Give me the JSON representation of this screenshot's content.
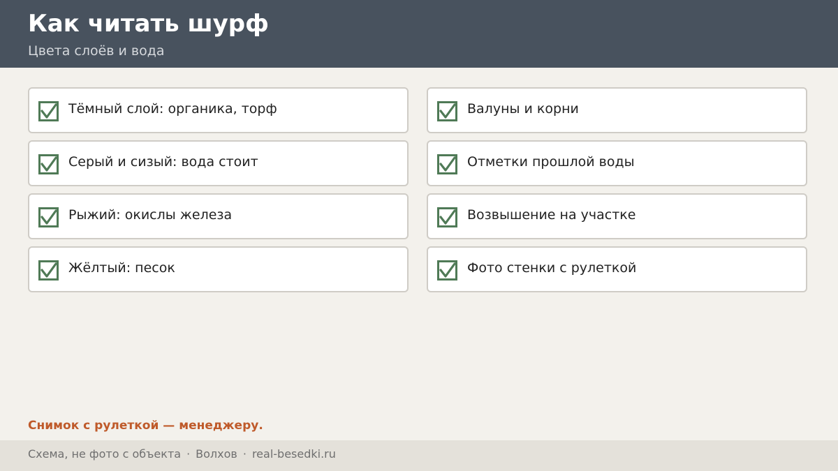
{
  "header": {
    "title": "Как читать шурф",
    "subtitle": "Цвета слоёв и вода"
  },
  "colors": {
    "header_bg": "#48525e",
    "page_bg": "#f3f1ec",
    "check_green": "#4f7a56",
    "accent": "#bf5a2a",
    "footer_bg": "#e4e1da"
  },
  "checklist": {
    "left": [
      {
        "label": "Тёмный слой: органика, торф",
        "icon": "checkbox-checked-icon",
        "checked": true
      },
      {
        "label": "Серый и сизый: вода стоит",
        "icon": "checkbox-checked-icon",
        "checked": true
      },
      {
        "label": "Рыжий: окислы железа",
        "icon": "checkbox-checked-icon",
        "checked": true
      },
      {
        "label": "Жёлтый: песок",
        "icon": "checkbox-checked-icon",
        "checked": true
      }
    ],
    "right": [
      {
        "label": "Валуны и корни",
        "icon": "checkbox-checked-icon",
        "checked": true
      },
      {
        "label": "Отметки прошлой воды",
        "icon": "checkbox-checked-icon",
        "checked": true
      },
      {
        "label": "Возвышение на участке",
        "icon": "checkbox-checked-icon",
        "checked": true
      },
      {
        "label": "Фото стенки с рулеткой",
        "icon": "checkbox-checked-icon",
        "checked": true
      }
    ]
  },
  "cta": {
    "text": "Снимок с рулеткой — менеджеру."
  },
  "footer": {
    "note": "Схема, не фото с объекта",
    "separator": "·",
    "city": "Волхов",
    "site": "real-besedki.ru"
  }
}
